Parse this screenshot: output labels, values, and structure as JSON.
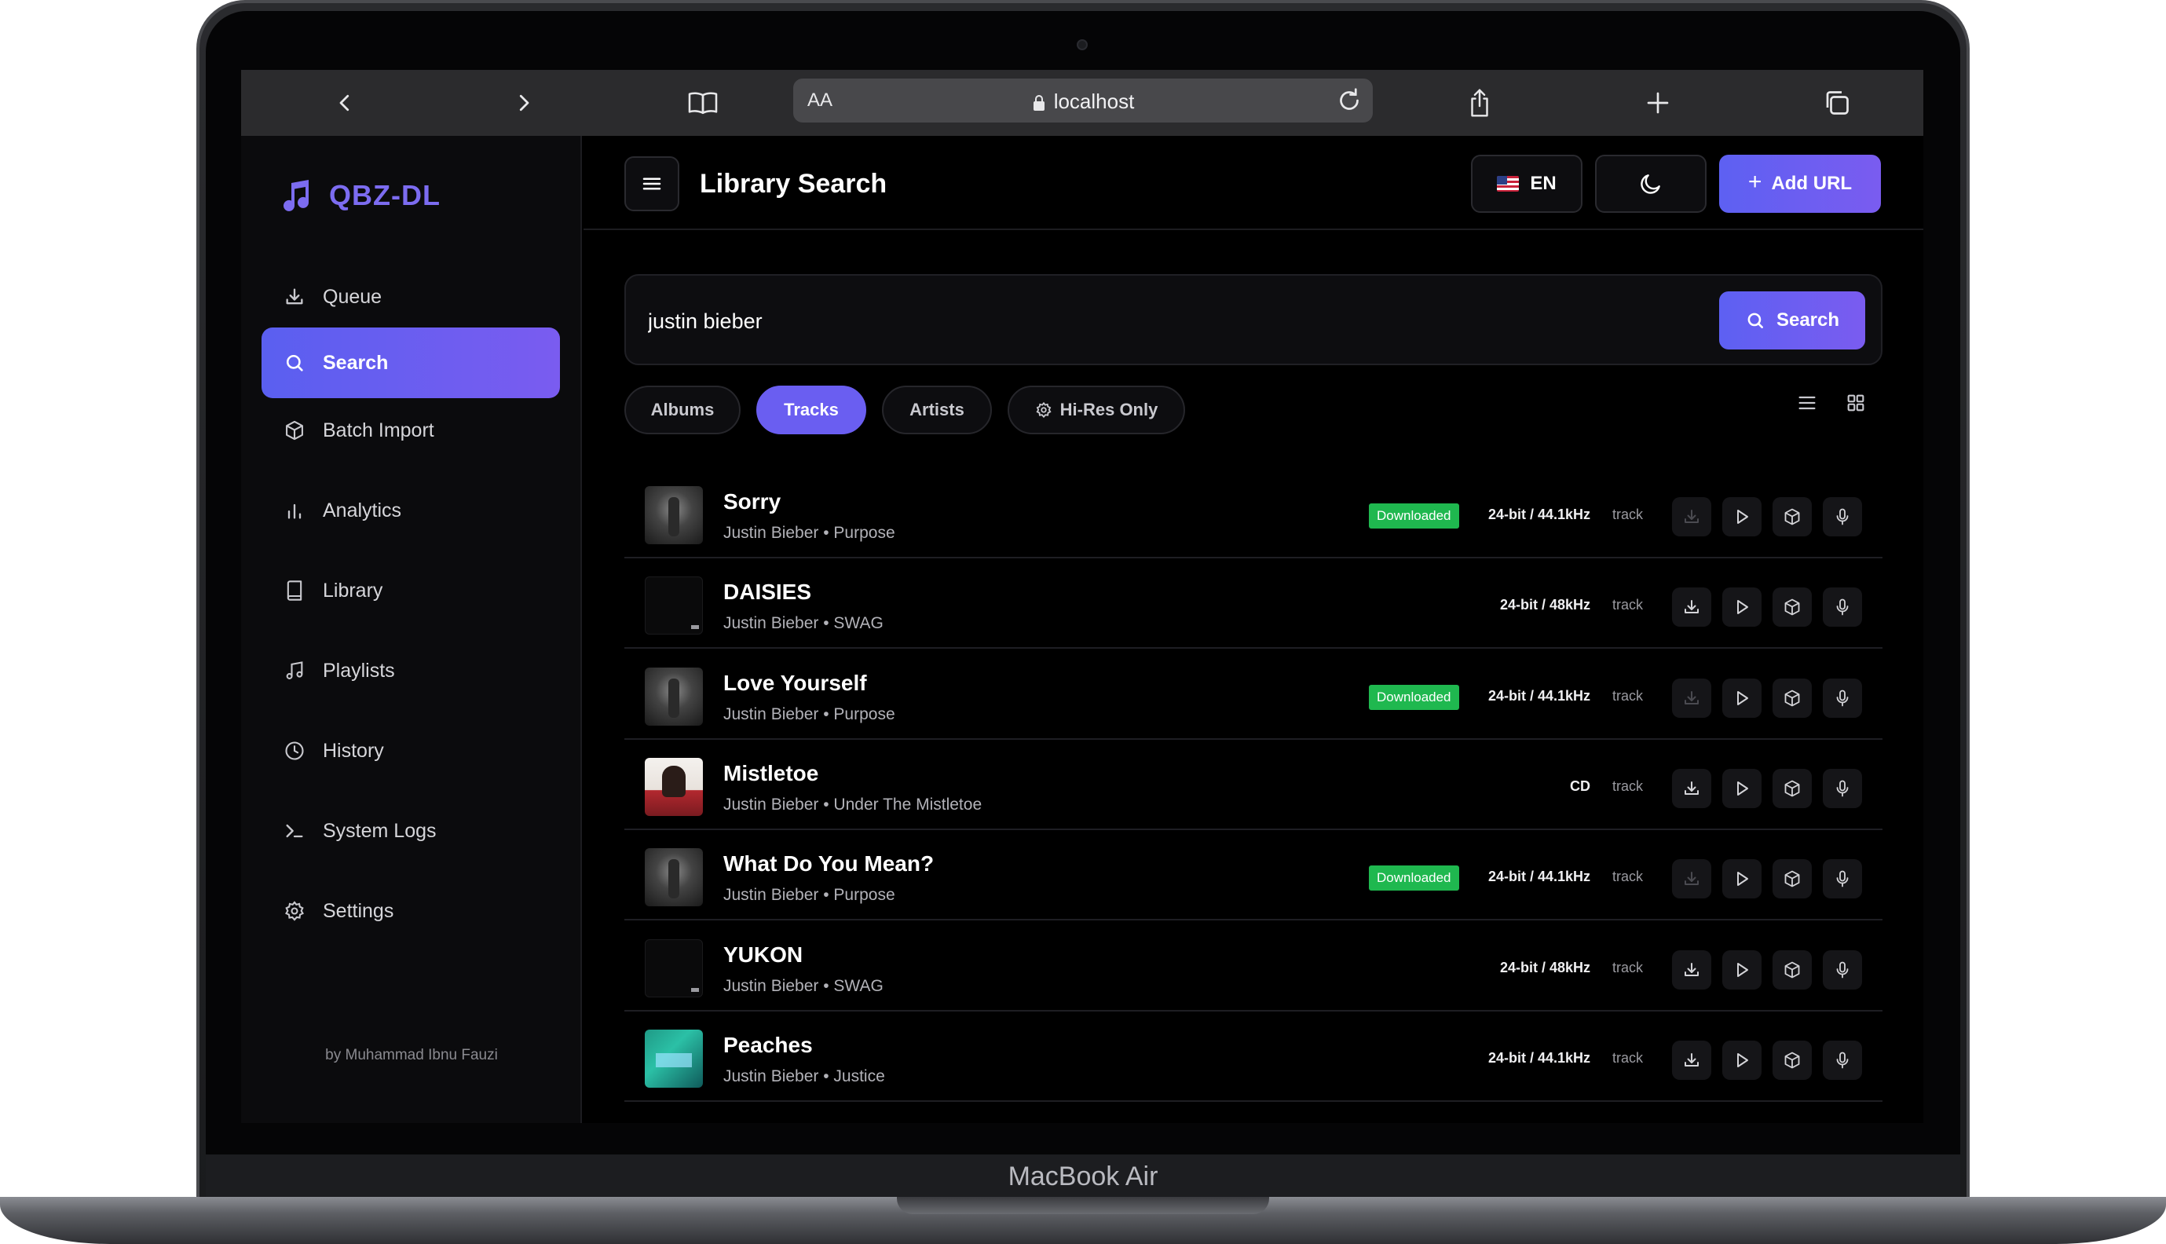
{
  "device": {
    "label": "MacBook Air"
  },
  "browser": {
    "text_size_label": "AA",
    "url": "localhost"
  },
  "app": {
    "name": "QBZ-DL",
    "credit": "by Muhammad Ibnu Fauzi",
    "accent_color": "#6a5ef1",
    "nav": [
      {
        "label": "Queue",
        "icon": "download-icon",
        "active": false
      },
      {
        "label": "Search",
        "icon": "search-icon",
        "active": true
      },
      {
        "label": "Batch Import",
        "icon": "package-icon",
        "active": false
      },
      {
        "label": "Analytics",
        "icon": "bar-chart-icon",
        "active": false
      },
      {
        "label": "Library",
        "icon": "book-icon",
        "active": false
      },
      {
        "label": "Playlists",
        "icon": "music-note-icon",
        "active": false
      },
      {
        "label": "History",
        "icon": "clock-icon",
        "active": false
      },
      {
        "label": "System Logs",
        "icon": "terminal-icon",
        "active": false
      },
      {
        "label": "Settings",
        "icon": "gear-icon",
        "active": false
      }
    ]
  },
  "header": {
    "title": "Library Search",
    "language": "EN",
    "add_url_label": "Add URL"
  },
  "search": {
    "query": "justin bieber",
    "button_label": "Search"
  },
  "filters": [
    {
      "label": "Albums",
      "active": false
    },
    {
      "label": "Tracks",
      "active": true
    },
    {
      "label": "Artists",
      "active": false
    },
    {
      "label": "Hi-Res Only",
      "active": false
    }
  ],
  "tracks": [
    {
      "title": "Sorry",
      "subtitle": "Justin Bieber • Purpose",
      "cover": "purpose",
      "badge": "Downloaded",
      "quality": "24-bit / 44.1kHz",
      "type": "track"
    },
    {
      "title": "DAISIES",
      "subtitle": "Justin Bieber • SWAG",
      "cover": "swag",
      "badge": "",
      "quality": "24-bit / 48kHz",
      "type": "track"
    },
    {
      "title": "Love Yourself",
      "subtitle": "Justin Bieber • Purpose",
      "cover": "purpose",
      "badge": "Downloaded",
      "quality": "24-bit / 44.1kHz",
      "type": "track"
    },
    {
      "title": "Mistletoe",
      "subtitle": "Justin Bieber • Under The Mistletoe",
      "cover": "mistletoe",
      "badge": "",
      "quality": "CD",
      "type": "track"
    },
    {
      "title": "What Do You Mean?",
      "subtitle": "Justin Bieber • Purpose",
      "cover": "purpose",
      "badge": "Downloaded",
      "quality": "24-bit / 44.1kHz",
      "type": "track"
    },
    {
      "title": "YUKON",
      "subtitle": "Justin Bieber • SWAG",
      "cover": "swag",
      "badge": "",
      "quality": "24-bit / 48kHz",
      "type": "track"
    },
    {
      "title": "Peaches",
      "subtitle": "Justin Bieber • Justice",
      "cover": "justice",
      "badge": "",
      "quality": "24-bit / 44.1kHz",
      "type": "track"
    }
  ]
}
